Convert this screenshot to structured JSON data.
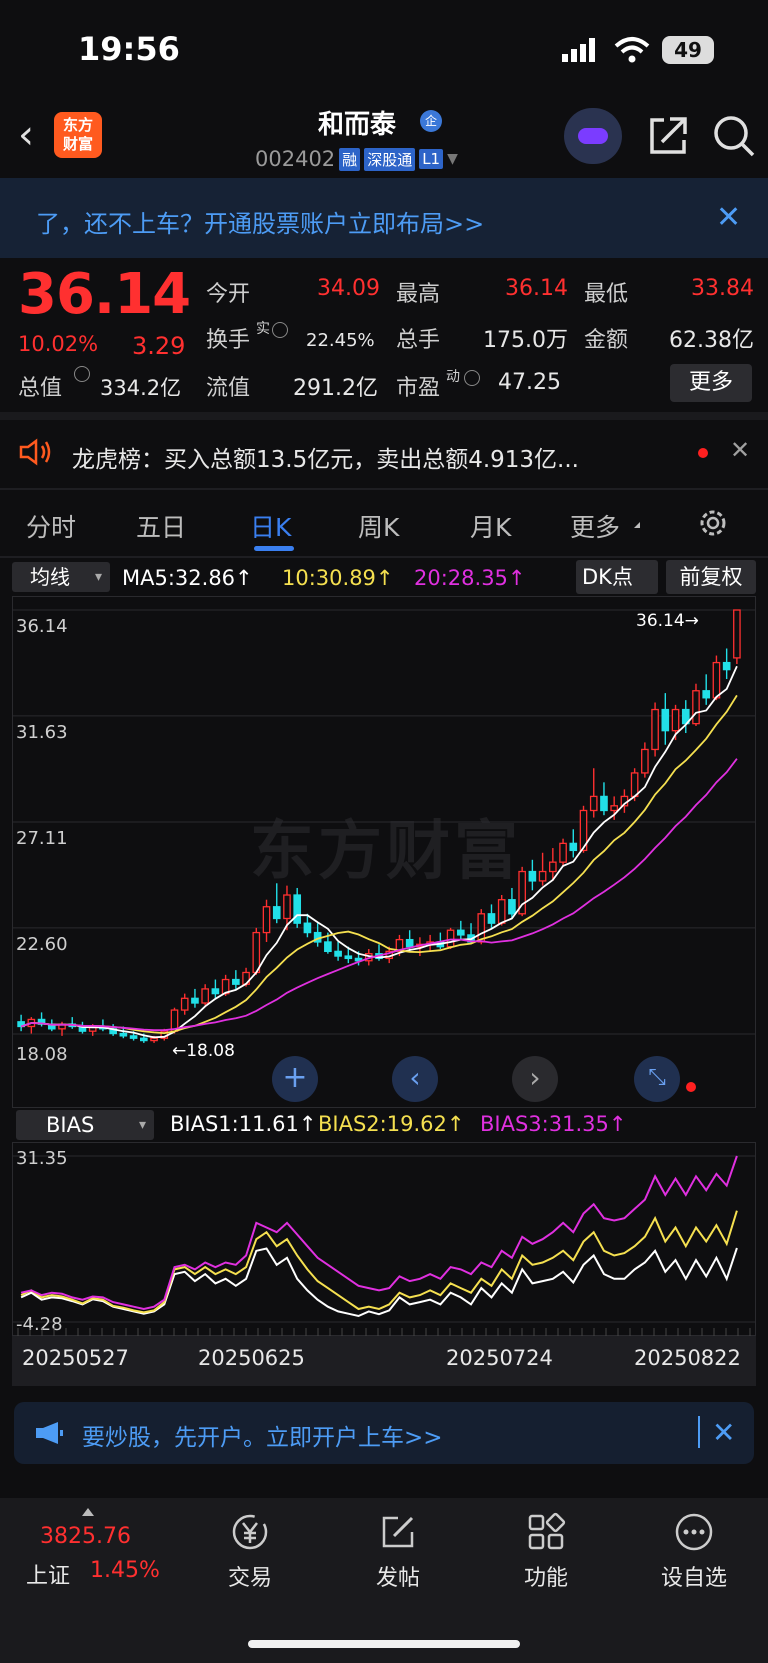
{
  "status_bar": {
    "time": "19:56",
    "battery": "49"
  },
  "header": {
    "logo_line1": "东方",
    "logo_line2": "财富",
    "stock_name": "和而泰",
    "badge_qi": "企",
    "stock_code": "002402",
    "tags": [
      "融",
      "深股通",
      "L1"
    ]
  },
  "promo_banner": {
    "text": "了，还不上车？开通股票账户立即布局>>",
    "close": "✕"
  },
  "quote": {
    "price": "36.14",
    "change_pct": "10.02%",
    "change": "3.29",
    "open_label": "今开",
    "open": "34.09",
    "high_label": "最高",
    "high": "36.14",
    "low_label": "最低",
    "low": "33.84",
    "turnover_label": "换手",
    "turnover_sup": "实",
    "turnover": "22.45%",
    "volume_label": "总手",
    "volume": "175.0万",
    "amount_label": "金额",
    "amount": "62.38亿",
    "mktcap_label": "总值",
    "mktcap": "334.2亿",
    "float_label": "流值",
    "float": "291.2亿",
    "pe_label": "市盈",
    "pe_sup": "动",
    "pe": "47.25",
    "more": "更多"
  },
  "dragon_tiger": {
    "text": "龙虎榜：买入总额13.5亿元，卖出总额4.913亿...",
    "close": "✕"
  },
  "tabs": [
    "分时",
    "五日",
    "日K",
    "周K",
    "月K",
    "更多"
  ],
  "active_tab": "日K",
  "ma": {
    "select": "均线",
    "ma5": "MA5:32.86↑",
    "ma10": "10:30.89↑",
    "ma20": "20:28.35↑",
    "dk": "DK点",
    "adjust": "前复权",
    "colors": {
      "ma5": "#ffffff",
      "ma10": "#f5e050",
      "ma20": "#e030e0"
    }
  },
  "chart_data": [
    {
      "type": "candlestick",
      "title": "",
      "y_ticks": [
        "36.14",
        "31.63",
        "27.11",
        "22.60",
        "18.08"
      ],
      "ylim": [
        18.08,
        36.14
      ],
      "last_price_label": "36.14→",
      "low_marker_label": "←18.08",
      "x_dates": [
        "20250527",
        "20250625",
        "20250724",
        "20250822"
      ],
      "candles": [
        [
          18.6,
          18.9,
          18.2,
          18.4
        ],
        [
          18.4,
          18.8,
          18.1,
          18.7
        ],
        [
          18.7,
          19.0,
          18.4,
          18.5
        ],
        [
          18.5,
          18.7,
          18.2,
          18.3
        ],
        [
          18.3,
          18.6,
          18.0,
          18.5
        ],
        [
          18.5,
          18.8,
          18.3,
          18.4
        ],
        [
          18.4,
          18.6,
          18.1,
          18.2
        ],
        [
          18.2,
          18.5,
          18.0,
          18.4
        ],
        [
          18.4,
          18.7,
          18.2,
          18.3
        ],
        [
          18.3,
          18.5,
          18.0,
          18.1
        ],
        [
          18.1,
          18.4,
          17.9,
          18.0
        ],
        [
          18.0,
          18.2,
          17.8,
          17.9
        ],
        [
          17.9,
          18.1,
          17.7,
          17.8
        ],
        [
          17.8,
          18.0,
          17.7,
          17.9
        ],
        [
          17.9,
          18.3,
          17.8,
          18.2
        ],
        [
          18.2,
          19.2,
          18.1,
          19.1
        ],
        [
          19.1,
          19.8,
          18.9,
          19.6
        ],
        [
          19.6,
          20.0,
          19.2,
          19.4
        ],
        [
          19.4,
          20.2,
          19.3,
          20.0
        ],
        [
          20.0,
          20.4,
          19.6,
          19.8
        ],
        [
          19.8,
          20.6,
          19.7,
          20.4
        ],
        [
          20.4,
          20.8,
          20.0,
          20.2
        ],
        [
          20.2,
          20.9,
          20.1,
          20.7
        ],
        [
          20.7,
          22.6,
          20.6,
          22.4
        ],
        [
          22.4,
          23.8,
          22.0,
          23.5
        ],
        [
          23.5,
          24.5,
          22.8,
          23.0
        ],
        [
          23.0,
          24.4,
          22.5,
          24.0
        ],
        [
          24.0,
          24.3,
          22.6,
          22.8
        ],
        [
          22.8,
          23.2,
          22.2,
          22.4
        ],
        [
          22.4,
          22.8,
          21.8,
          22.0
        ],
        [
          22.0,
          22.4,
          21.5,
          21.6
        ],
        [
          21.6,
          22.0,
          21.2,
          21.4
        ],
        [
          21.4,
          21.8,
          21.1,
          21.3
        ],
        [
          21.3,
          21.6,
          21.0,
          21.2
        ],
        [
          21.2,
          21.7,
          21.0,
          21.5
        ],
        [
          21.5,
          21.9,
          21.2,
          21.3
        ],
        [
          21.3,
          21.8,
          21.1,
          21.6
        ],
        [
          21.6,
          22.3,
          21.4,
          22.1
        ],
        [
          22.1,
          22.5,
          21.6,
          21.8
        ],
        [
          21.8,
          22.2,
          21.4,
          21.9
        ],
        [
          21.9,
          22.3,
          21.6,
          22.0
        ],
        [
          22.0,
          22.4,
          21.7,
          21.8
        ],
        [
          21.8,
          22.6,
          21.7,
          22.5
        ],
        [
          22.5,
          22.9,
          22.1,
          22.3
        ],
        [
          22.3,
          22.8,
          21.9,
          22.0
        ],
        [
          22.0,
          23.4,
          21.9,
          23.2
        ],
        [
          23.2,
          23.6,
          22.6,
          22.8
        ],
        [
          22.8,
          24.0,
          22.7,
          23.8
        ],
        [
          23.8,
          24.3,
          23.0,
          23.2
        ],
        [
          23.2,
          25.2,
          23.1,
          25.0
        ],
        [
          25.0,
          25.5,
          24.2,
          24.6
        ],
        [
          24.6,
          25.8,
          24.4,
          25.0
        ],
        [
          25.0,
          26.0,
          24.6,
          25.4
        ],
        [
          25.4,
          26.4,
          25.2,
          26.2
        ],
        [
          26.2,
          26.8,
          25.6,
          25.9
        ],
        [
          25.9,
          27.8,
          25.8,
          27.6
        ],
        [
          27.6,
          29.4,
          27.3,
          28.2
        ],
        [
          28.2,
          28.8,
          27.4,
          27.6
        ],
        [
          27.6,
          28.2,
          27.2,
          27.8
        ],
        [
          27.8,
          28.5,
          27.5,
          28.2
        ],
        [
          28.2,
          29.4,
          28.0,
          29.2
        ],
        [
          29.2,
          30.5,
          29.0,
          30.2
        ],
        [
          30.2,
          32.2,
          29.9,
          31.9
        ],
        [
          31.9,
          32.6,
          30.4,
          31.0
        ],
        [
          31.0,
          32.1,
          30.6,
          31.9
        ],
        [
          31.9,
          32.3,
          30.9,
          31.3
        ],
        [
          31.3,
          33.0,
          31.2,
          32.7
        ],
        [
          32.7,
          33.4,
          32.1,
          32.4
        ],
        [
          32.4,
          34.2,
          32.3,
          33.9
        ],
        [
          33.9,
          34.5,
          33.2,
          33.6
        ],
        [
          34.1,
          36.14,
          33.84,
          36.14
        ]
      ],
      "series": [
        {
          "name": "MA5",
          "color": "#ffffff"
        },
        {
          "name": "MA10",
          "color": "#f5e050"
        },
        {
          "name": "MA20",
          "color": "#e030e0"
        }
      ]
    },
    {
      "type": "line",
      "title": "BIAS",
      "y_ticks": [
        "31.35",
        "-4.28"
      ],
      "ylim": [
        -4.28,
        31.35
      ],
      "series": [
        {
          "name": "BIAS1",
          "color": "#ffffff",
          "values": [
            1,
            2,
            0.5,
            1,
            0.8,
            0.2,
            -0.5,
            0.6,
            0.2,
            -1,
            -1.5,
            -2,
            -2.5,
            -2,
            -0.5,
            6,
            6.5,
            4.5,
            6,
            4,
            5,
            3.5,
            5,
            11,
            11.5,
            8,
            9.5,
            5,
            2.5,
            0.5,
            -1,
            -2,
            -2.5,
            -3,
            -2,
            -2.6,
            -1.8,
            1,
            -0.5,
            0,
            0.5,
            -0.5,
            2,
            1,
            -0.5,
            3,
            1,
            4,
            2,
            7,
            4,
            4.5,
            5,
            6.5,
            4.2,
            8,
            10,
            6,
            5,
            5,
            7,
            8.5,
            11,
            6.5,
            9,
            5,
            9,
            5.5,
            9.5,
            5,
            11.61
          ]
        },
        {
          "name": "BIAS2",
          "color": "#f5e050",
          "values": [
            1.5,
            2.5,
            1,
            1.5,
            1.2,
            0.5,
            -0.3,
            0.8,
            0.5,
            -0.8,
            -1.2,
            -1.8,
            -2.2,
            -1.8,
            0,
            7,
            7.5,
            6,
            7.5,
            6,
            7,
            6,
            7.5,
            13.5,
            15,
            12,
            13.5,
            10,
            7,
            4.5,
            3,
            1.5,
            0,
            -1.5,
            -1,
            -1.5,
            -0.5,
            2,
            1,
            1.5,
            2.5,
            1.5,
            4,
            3,
            2,
            5,
            3.5,
            7,
            5,
            10,
            8,
            8.5,
            9.5,
            11,
            9,
            13,
            15,
            11,
            10,
            10.5,
            12,
            14,
            18,
            13,
            16,
            12,
            16,
            13,
            16.5,
            12.5,
            19.62
          ]
        },
        {
          "name": "BIAS3",
          "color": "#e030e0",
          "values": [
            2,
            2.5,
            1.5,
            2,
            1.8,
            1,
            0.5,
            1.2,
            1,
            0,
            -0.5,
            -1,
            -1.5,
            -1,
            0.5,
            7.5,
            8,
            7,
            8.5,
            7.5,
            8.5,
            8,
            10,
            17,
            16,
            15,
            17,
            14.5,
            12,
            9.5,
            8,
            6.5,
            5,
            3.5,
            3,
            2.5,
            3,
            5.5,
            4.5,
            5,
            6,
            5,
            7.5,
            7,
            6,
            8.5,
            7.5,
            11,
            9.5,
            14,
            12.5,
            13.5,
            15,
            17,
            15,
            19,
            21,
            18,
            17.5,
            18,
            20,
            22,
            27,
            23,
            26.5,
            23,
            27,
            24,
            27.5,
            25,
            31.35
          ]
        }
      ]
    }
  ],
  "bias": {
    "select": "BIAS",
    "b1": "BIAS1:11.61↑",
    "b2": "BIAS2:19.62↑",
    "b3": "BIAS3:31.35↑"
  },
  "watermark": "东方财富",
  "bottom_promo": {
    "text": "要炒股，先开户。立即开户上车>>",
    "close": "✕"
  },
  "bottom_nav": {
    "index_value": "3825.76",
    "index_name": "上证",
    "index_pct": "1.45%",
    "items": [
      {
        "label": "交易",
        "icon": "yen-icon"
      },
      {
        "label": "发帖",
        "icon": "edit-icon"
      },
      {
        "label": "功能",
        "icon": "grid-icon"
      },
      {
        "label": "设自选",
        "icon": "more-icon"
      }
    ]
  }
}
